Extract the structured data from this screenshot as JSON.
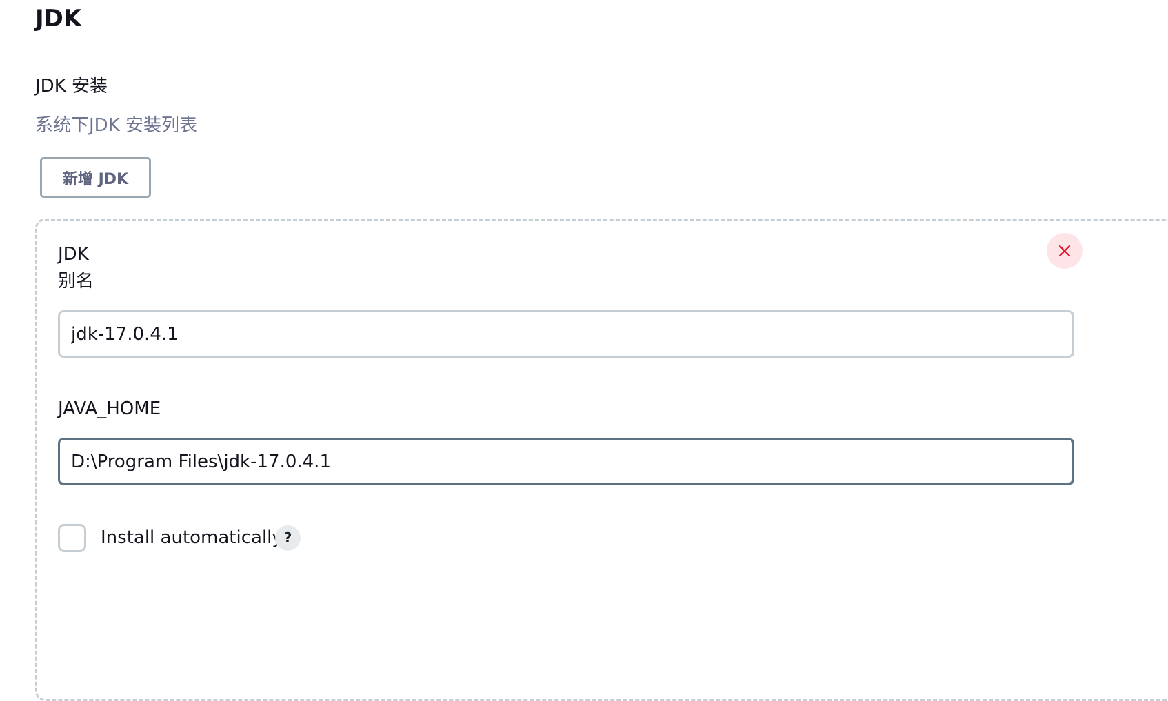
{
  "section": {
    "title": "JDK"
  },
  "jdk_installations": {
    "label": "JDK 安装",
    "description": "系统下JDK 安装列表",
    "add_button_label": "新增 JDK"
  },
  "jdk_entry": {
    "name_label_line1": "JDK",
    "name_label_line2": "别名",
    "name_value": "jdk-17.0.4.1",
    "java_home_label": "JAVA_HOME",
    "java_home_value": "D:\\Program Files\\jdk-17.0.4.1",
    "install_auto_label": "Install automatically",
    "install_auto_checked": false,
    "help_glyph": "?",
    "delete_icon": "close-icon"
  },
  "colors": {
    "delete_icon": "#e2102a",
    "delete_bg": "#fde4e7",
    "focused_border": "#5c7182",
    "description_text": "#6e7491"
  }
}
